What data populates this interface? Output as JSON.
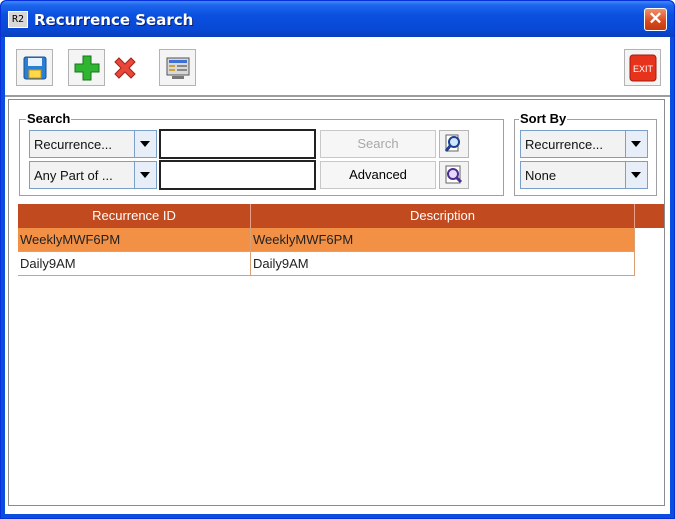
{
  "window": {
    "title": "Recurrence Search",
    "icon_text": "R2",
    "close_glyph": "✕"
  },
  "toolbar": {
    "buttons": [
      {
        "name": "save",
        "icon": "floppy-disk-icon"
      },
      {
        "name": "add",
        "icon": "green-plus-icon"
      },
      {
        "name": "delete",
        "icon": "red-x-icon"
      },
      {
        "name": "view",
        "icon": "screen-list-icon"
      },
      {
        "name": "exit",
        "icon": "exit-icon",
        "label": "EXIT"
      }
    ]
  },
  "search": {
    "group_title": "Search",
    "field_combo": "Recurrence...",
    "match_combo": "Any Part of ...",
    "field1_value": "",
    "field2_value": "",
    "search_label": "Search",
    "advanced_label": "Advanced"
  },
  "sort": {
    "group_title": "Sort By",
    "field_combo": "Recurrence...",
    "order_combo": "None"
  },
  "table": {
    "columns": [
      "Recurrence ID",
      "Description"
    ],
    "rows": [
      {
        "id": "WeeklyMWF6PM",
        "description": "WeeklyMWF6PM",
        "selected": true
      },
      {
        "id": "Daily9AM",
        "description": "Daily9AM",
        "selected": false
      }
    ]
  },
  "colors": {
    "header": "#c14a1e",
    "selected_row": "#f29045",
    "title_bar": "#0a50e0"
  }
}
